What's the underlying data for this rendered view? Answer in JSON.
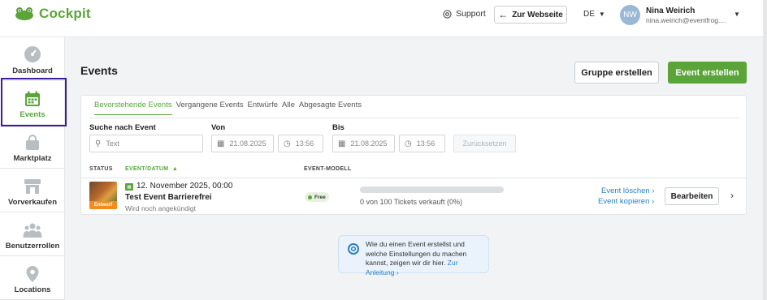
{
  "app": {
    "logo_text": "Cockpit",
    "brand_color": "#5aa43a",
    "accent_link_color": "#2a7fc4"
  },
  "header": {
    "support_label": "Support",
    "website_button": "Zur Webseite",
    "language": "DE",
    "user": {
      "initials": "NW",
      "name": "Nina Weirich",
      "email": "nina.weirich@eventfrog...."
    }
  },
  "sidebar": {
    "items": [
      {
        "label": "Dashboard",
        "icon": "gauge-icon",
        "active": false
      },
      {
        "label": "Events",
        "icon": "calendar-icon",
        "active": true
      },
      {
        "label": "Marktplatz",
        "icon": "shopping-bag-icon",
        "active": false
      },
      {
        "label": "Vorverkaufen",
        "icon": "storefront-icon",
        "active": false
      },
      {
        "label": "Benutzerrollen",
        "icon": "users-icon",
        "active": false
      },
      {
        "label": "Locations",
        "icon": "map-pin-icon",
        "active": false
      }
    ]
  },
  "main": {
    "title": "Events",
    "create_group_button": "Gruppe erstellen",
    "create_event_button": "Event erstellen",
    "tabs": [
      {
        "label": "Bevorstehende Events",
        "active": true
      },
      {
        "label": "Vergangene Events",
        "active": false
      },
      {
        "label": "Entwürfe",
        "active": false
      },
      {
        "label": "Alle",
        "active": false
      },
      {
        "label": "Abgesagte Events",
        "active": false
      }
    ],
    "filters": {
      "search_label": "Suche nach Event",
      "search_placeholder": "Text",
      "from_label": "Von",
      "from_date": "21.08.2025",
      "from_time": "13:56",
      "to_label": "Bis",
      "to_date": "21.08.2025",
      "to_time": "13:56",
      "reset_button": "Zurücksetzen"
    },
    "table": {
      "headers": {
        "status": "STATUS",
        "event_date": "EVENT/DATUM",
        "event_model": "EVENT-MODELL"
      },
      "rows": [
        {
          "status_badge": "Entwurf",
          "date": "12. November 2025, 00:00",
          "name": "Test Event Barrierefrei",
          "subtitle": "Wird noch angekündigt",
          "model": "Free",
          "tickets_sold_fraction": 0,
          "tickets_text": "0 von 100 Tickets verkauft (0%)",
          "delete_link": "Event löschen",
          "copy_link": "Event kopieren",
          "edit_button": "Bearbeiten"
        }
      ]
    }
  },
  "info": {
    "text": "Wie du einen Event erstellst und welche Einstellungen du machen kannst, zeigen wir dir hier.",
    "link": "Zur Anleitung"
  }
}
